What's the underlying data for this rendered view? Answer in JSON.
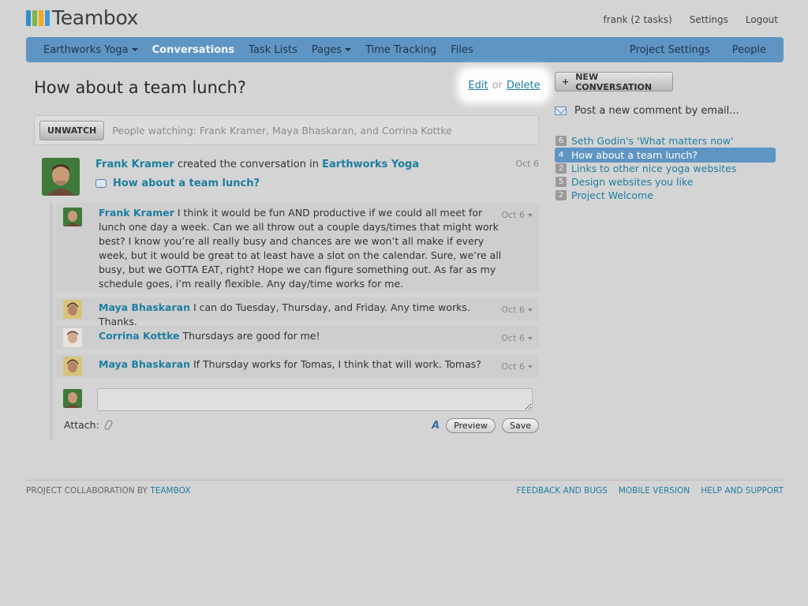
{
  "brand": {
    "name": "Teambox",
    "block_colors": [
      "#2f8fc7",
      "#7fb34a",
      "#f2a81d",
      "#3a9ad9"
    ]
  },
  "toplinks": [
    "frank (2 tasks)",
    "Settings",
    "Logout"
  ],
  "nav": {
    "left": [
      {
        "label": "Earthworks Yoga",
        "dropdown": true
      },
      {
        "label": "Conversations",
        "active": true
      },
      {
        "label": "Task Lists"
      },
      {
        "label": "Pages",
        "dropdown": true
      },
      {
        "label": "Time Tracking"
      },
      {
        "label": "Files"
      }
    ],
    "right": [
      "Project Settings",
      "People"
    ],
    "bar_color": "#5e95c2"
  },
  "page": {
    "title": "How about a team lunch?",
    "edit_label": "Edit",
    "or_label": "or",
    "delete_label": "Delete"
  },
  "watch": {
    "button_label": "UNWATCH",
    "text": "People watching: Frank Kramer, Maya Bhaskaran, and Corrina Kottke"
  },
  "starter": {
    "author": "Frank Kramer",
    "action": "created the conversation in",
    "project": "Earthworks Yoga",
    "date": "Oct 6",
    "subject": "How about a team lunch?"
  },
  "comments": [
    {
      "author": "Frank Kramer",
      "text": "I think it would be fun AND productive if we could all meet for lunch one day a week. Can we all throw out a couple days/times that might work best? I know you’re all really busy and chances are we won’t all make if every week, but it would be great to at least have a slot on the calendar. Sure, we’re all busy, but we GOTTA EAT, right? Hope we can figure something out. As far as my schedule goes, i’m really flexible. Any day/time works for me.",
      "date": "Oct 6"
    },
    {
      "author": "Maya Bhaskaran",
      "text": "I can do Tuesday, Thursday, and Friday. Any time works. Thanks.",
      "date": "Oct 6"
    },
    {
      "author": "Corrina Kottke",
      "text": "Thursdays are good for me!",
      "date": "Oct 6"
    },
    {
      "author": "Maya Bhaskaran",
      "text": "If Thursday works for Tomas, I think that will work. Tomas?",
      "date": "Oct 6"
    }
  ],
  "reply": {
    "value": "",
    "attach_label": "Attach:",
    "preview_label": "Preview",
    "save_label": "Save"
  },
  "sidebar": {
    "new_conversation_label": "NEW CONVERSATION",
    "email_label": "Post a new comment by email...",
    "conversations": [
      {
        "count": "6",
        "title": "Seth Godin's 'What matters now'"
      },
      {
        "count": "4",
        "title": "How about a team lunch?",
        "active": true
      },
      {
        "count": "2",
        "title": "Links to other nice yoga websites"
      },
      {
        "count": "5",
        "title": "Design websites you like"
      },
      {
        "count": "2",
        "title": "Project Welcome"
      }
    ]
  },
  "footer": {
    "left_prefix": "PROJECT COLLABORATION BY",
    "left_link": "TEAMBOX",
    "links": [
      "FEEDBACK AND BUGS",
      "MOBILE VERSION",
      "HELP AND SUPPORT"
    ]
  }
}
